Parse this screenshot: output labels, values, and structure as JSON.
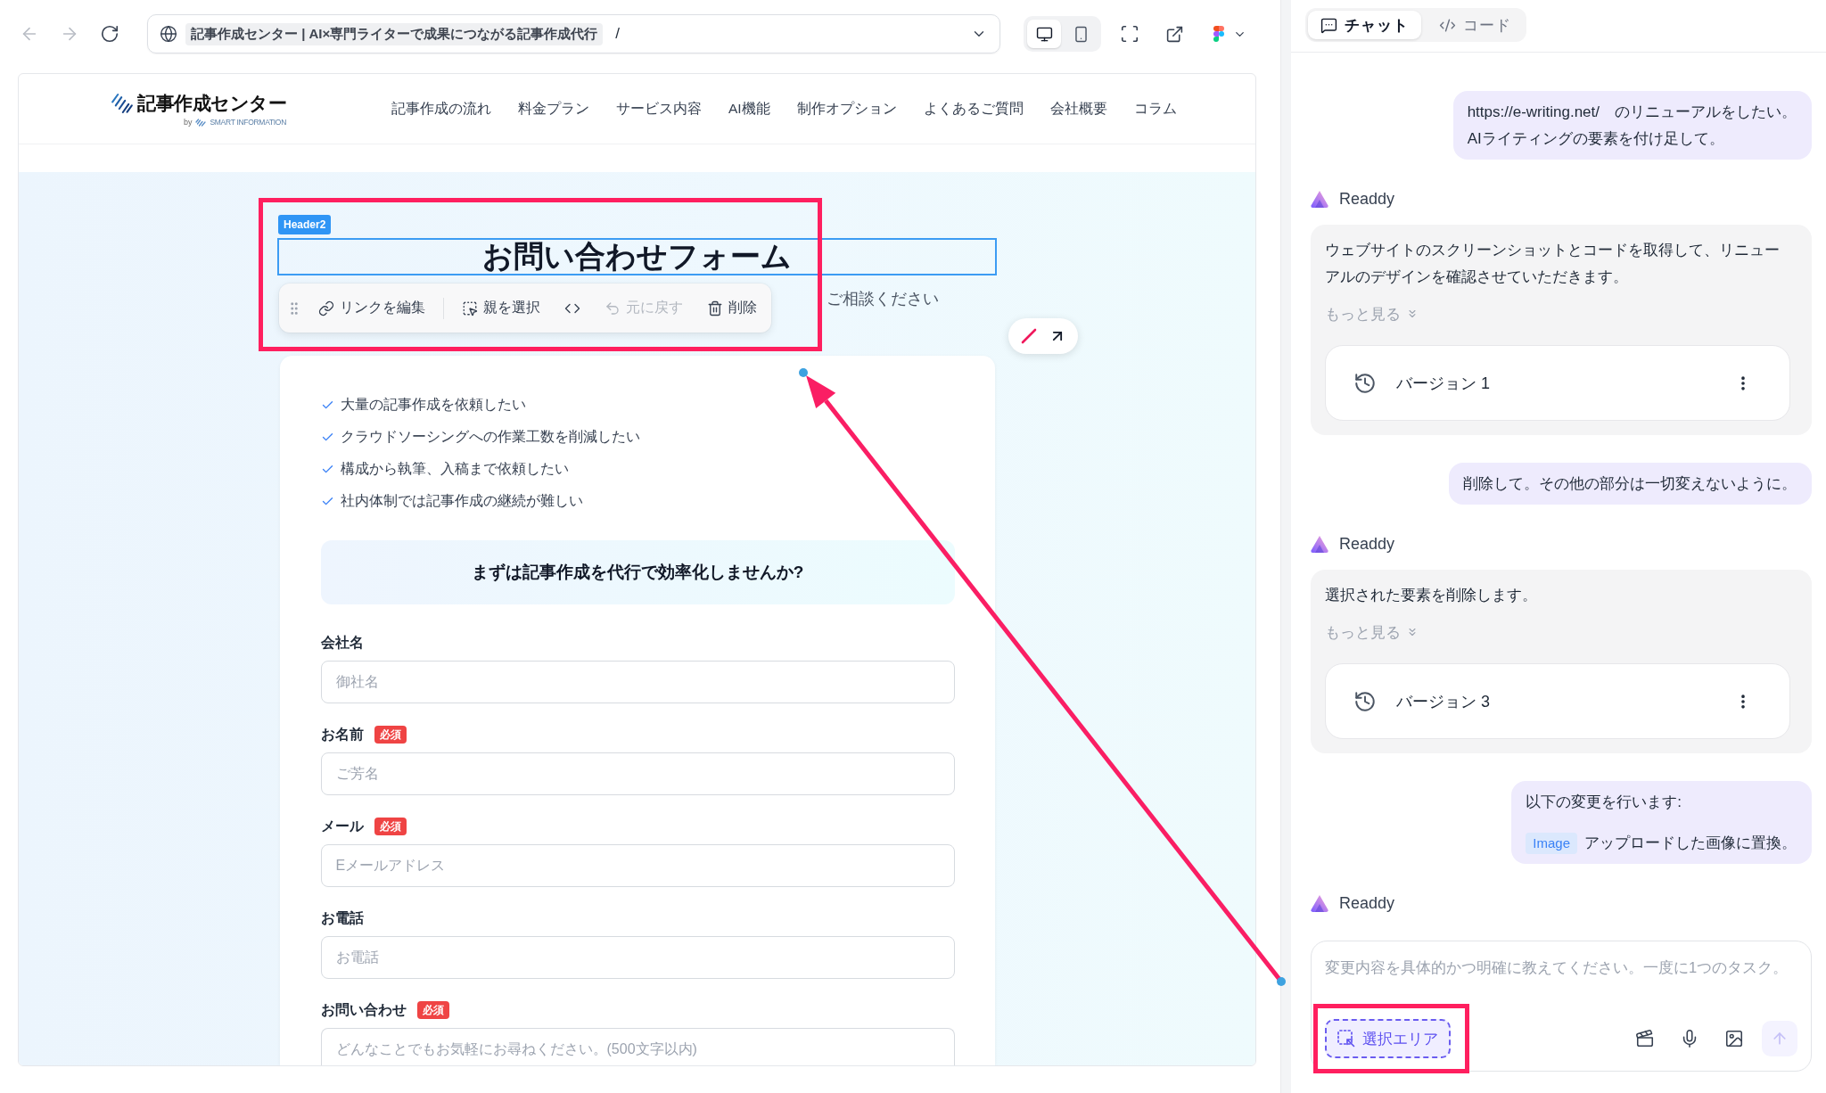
{
  "browser": {
    "nav_buttons": [
      {
        "kind": "back",
        "disabled": true
      },
      {
        "kind": "forward",
        "disabled": true
      },
      {
        "kind": "reload",
        "disabled": false
      }
    ],
    "page_title": "記事作成センター | AI×専門ライターで成果につながる記事作成代行",
    "path": "/",
    "view_modes": [
      {
        "kind": "desktop",
        "selected": true
      },
      {
        "kind": "mobile",
        "selected": false
      }
    ]
  },
  "site": {
    "logo": {
      "name": "記事作成センター",
      "by": "by",
      "company": "SMART INFORMATION"
    },
    "nav": [
      "記事作成の流れ",
      "料金プラン",
      "サービス内容",
      "AI機能",
      "制作オプション",
      "よくあるご質問",
      "会社概要",
      "コラム"
    ],
    "selected_element": {
      "tag": "Header2",
      "title": "お問い合わせフォーム",
      "subtitle": "ご相談ください"
    },
    "edit_toolbar": [
      {
        "kind": "link",
        "label": "リンクを編集",
        "disabled": false
      },
      {
        "kind": "select_parent",
        "label": "親を選択",
        "disabled": false
      },
      {
        "kind": "code",
        "disabled": false
      },
      {
        "kind": "undo",
        "label": "元に戻す",
        "disabled": true
      },
      {
        "kind": "delete",
        "label": "削除",
        "disabled": false
      }
    ],
    "checklist": [
      "大量の記事作成を依頼したい",
      "クラウドソーシングへの作業工数を削減したい",
      "構成から執筆、入稿まで依頼したい",
      "社内体制では記事作成の継続が難しい"
    ],
    "callout": "まずは記事作成を代行で効率化しませんか?",
    "fields": [
      {
        "kind": "input",
        "label": "会社名",
        "placeholder": "御社名"
      },
      {
        "kind": "input",
        "label": "お名前",
        "badge": "必須",
        "placeholder": "ご芳名"
      },
      {
        "kind": "input",
        "label": "メール",
        "badge": "必須",
        "placeholder": "Eメールアドレス"
      },
      {
        "kind": "input",
        "label": "お電話",
        "placeholder": "お電話"
      },
      {
        "kind": "textarea",
        "label": "お問い合わせ",
        "badge": "必須",
        "placeholder": "どんなことでもお気軽にお尋ねください。(500文字以内)"
      }
    ]
  },
  "chat": {
    "tabs": [
      {
        "kind": "chat",
        "label": "チャット",
        "selected": true
      },
      {
        "kind": "code",
        "label": "コード",
        "selected": false
      }
    ],
    "messages": [
      {
        "kind": "user",
        "text": "https://e-writing.net/　のリニューアルをしたい。\nAIライティングの要素を付け足して。"
      },
      {
        "kind": "assistant",
        "sender": "Readdy",
        "text": "ウェブサイトのスクリーンショットとコードを取得して、リニューアルのデザインを確認させていただきます。",
        "more": "もっと見る",
        "version": "バージョン 1"
      },
      {
        "kind": "user",
        "text": "削除して。その他の部分は一切変えないように。"
      },
      {
        "kind": "assistant",
        "sender": "Readdy",
        "text": "選択された要素を削除します。",
        "more": "もっと見る",
        "version": "バージョン 3"
      },
      {
        "kind": "user",
        "text": "以下の変更を行います:",
        "tag": "Image",
        "tag_text": "アップロードした画像に置換。"
      },
      {
        "kind": "assistant",
        "sender": "Readdy"
      }
    ],
    "composer": {
      "placeholder": "変更内容を具体的かつ明確に教えてください。一度に1つのタスク。",
      "select_area": "選択エリア",
      "send_disabled": true
    }
  }
}
